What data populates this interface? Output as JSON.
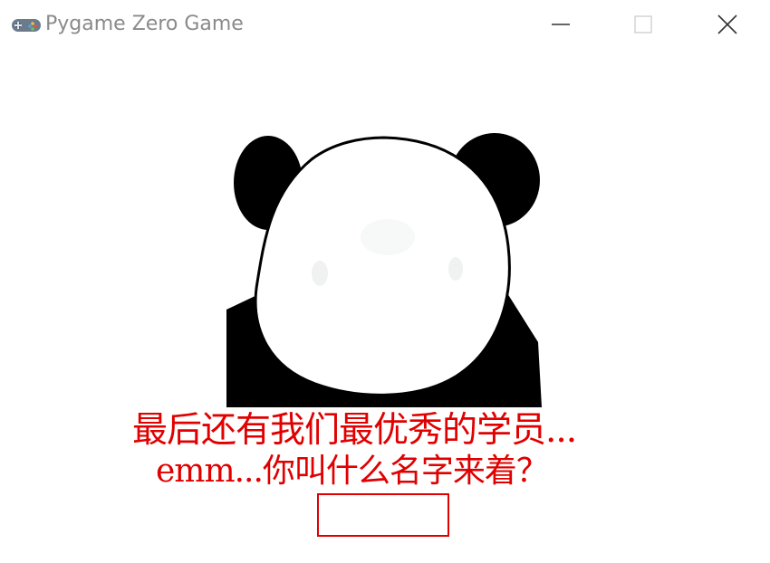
{
  "window": {
    "title": "Pygame Zero Game",
    "icons": {
      "app": "gamepad-icon",
      "minimize": "minimize-icon",
      "maximize": "maximize-icon",
      "close": "close-icon"
    }
  },
  "game": {
    "image": "panda-meme-face",
    "dialogue": {
      "line1": "最后还有我们最优秀的学员...",
      "line2": "emm...你叫什么名字来着？"
    },
    "name_input": {
      "value": "",
      "placeholder": ""
    },
    "colors": {
      "text": "#e00000",
      "input_border": "#e00000",
      "background": "#ffffff"
    }
  }
}
